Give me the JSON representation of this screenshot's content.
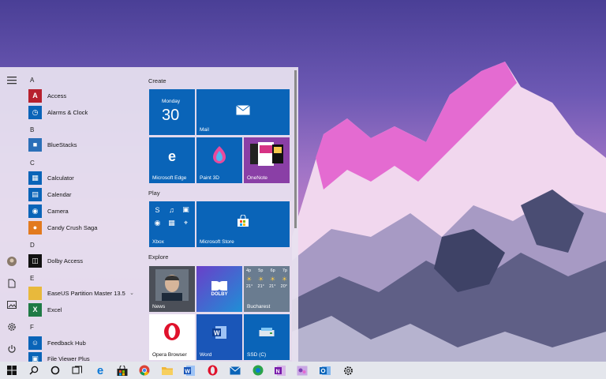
{
  "app_list": {
    "letters": [
      "A",
      "B",
      "C",
      "D",
      "E",
      "F"
    ],
    "apps": [
      {
        "label": "Access",
        "icon": "access-icon",
        "color": "#b7202e",
        "glyph": "A"
      },
      {
        "label": "Alarms & Clock",
        "icon": "alarm-clock-icon",
        "color": "#0a64b8",
        "glyph": "◷"
      },
      {
        "label": "BlueStacks",
        "icon": "bluestacks-icon",
        "color": "#2b6fb8",
        "glyph": "■"
      },
      {
        "label": "Calculator",
        "icon": "calculator-icon",
        "color": "#0a64b8",
        "glyph": "▦"
      },
      {
        "label": "Calendar",
        "icon": "calendar-icon",
        "color": "#0a64b8",
        "glyph": "▤"
      },
      {
        "label": "Camera",
        "icon": "camera-icon",
        "color": "#0a64b8",
        "glyph": "◉"
      },
      {
        "label": "Candy Crush Saga",
        "icon": "candy-crush-icon",
        "color": "#e27a1f",
        "glyph": "●"
      },
      {
        "label": "Dolby Access",
        "icon": "dolby-icon",
        "color": "#111111",
        "glyph": "◫"
      },
      {
        "label": "EaseUS Partition Master 13.5",
        "icon": "folder-icon",
        "color": "#e8b93c",
        "glyph": ""
      },
      {
        "label": "Excel",
        "icon": "excel-icon",
        "color": "#1f7a45",
        "glyph": "X"
      },
      {
        "label": "Feedback Hub",
        "icon": "feedback-hub-icon",
        "color": "#0a64b8",
        "glyph": "☺"
      },
      {
        "label": "File Viewer Plus",
        "icon": "file-viewer-icon",
        "color": "#0a64b8",
        "glyph": "▣"
      }
    ]
  },
  "groups": {
    "create": "Create",
    "play": "Play",
    "explore": "Explore"
  },
  "tiles": {
    "calendar_day": "Monday",
    "calendar_date": "30",
    "mail": "Mail",
    "edge": "Microsoft Edge",
    "paint3d": "Paint 3D",
    "onenote": "OneNote",
    "games": "Xbox",
    "store": "Microsoft Store",
    "news": "News",
    "dolby": "DOLBY",
    "weather_days": [
      "4p",
      "5p",
      "6p",
      "7p"
    ],
    "weather_temps": [
      "21°",
      "21°",
      "21°",
      "20°"
    ],
    "weather_city": "Bucharest",
    "opera": "Opera Browser",
    "word": "Word",
    "ssd": "SSD (C)"
  },
  "taskbar": {
    "items": [
      "start-icon",
      "search-icon",
      "cortana-icon",
      "task-view-icon",
      "edge-icon",
      "store-icon",
      "chrome-icon",
      "file-explorer-icon",
      "word-icon",
      "opera-icon",
      "mail-icon",
      "edge-alt-icon",
      "onenote-icon",
      "outlook-icon",
      "settings-icon"
    ]
  }
}
